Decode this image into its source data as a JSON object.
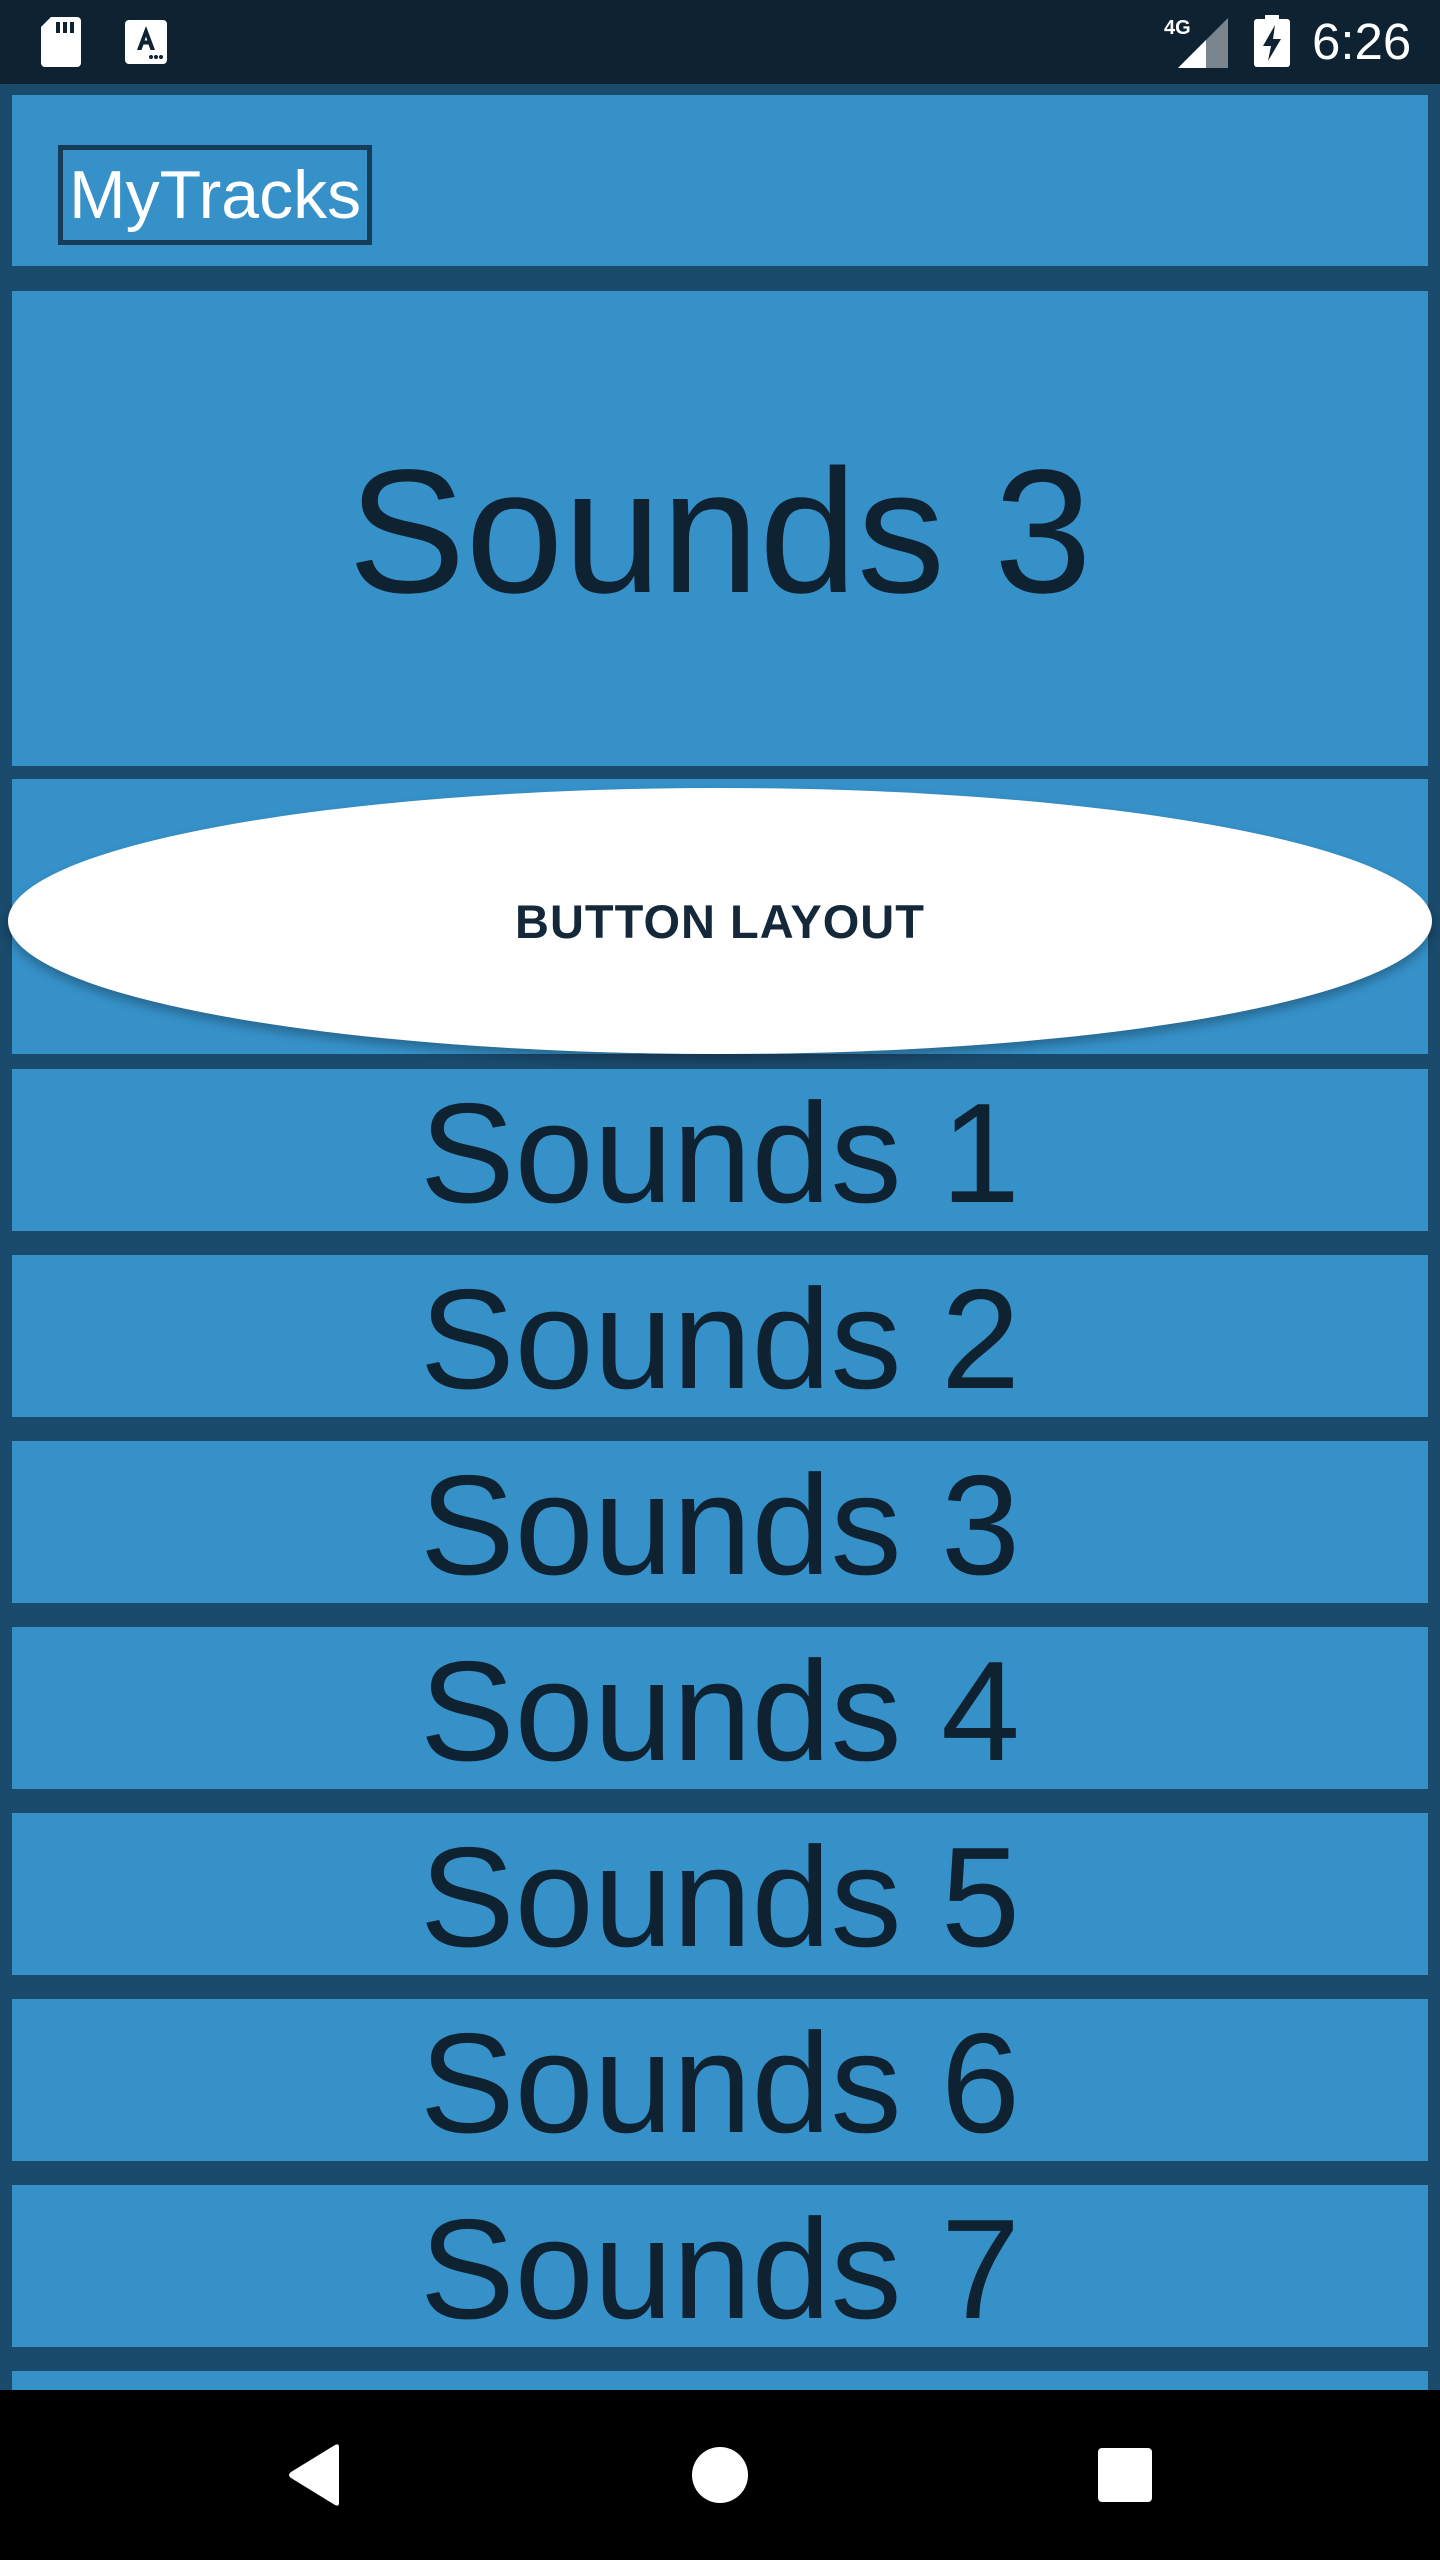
{
  "status_bar": {
    "time": "6:26",
    "network_type": "4G",
    "icons": [
      "sd-card-icon",
      "font-download-icon",
      "signal-4g-icon",
      "battery-charging-icon"
    ]
  },
  "app_bar": {
    "title": "MyTracks"
  },
  "hero": {
    "label": "Sounds 3"
  },
  "layout_button": {
    "label": "BUTTON LAYOUT"
  },
  "tracks": [
    {
      "label": "Sounds 1"
    },
    {
      "label": "Sounds 2"
    },
    {
      "label": "Sounds 3"
    },
    {
      "label": "Sounds 4"
    },
    {
      "label": "Sounds 5"
    },
    {
      "label": "Sounds 6"
    },
    {
      "label": "Sounds 7"
    }
  ],
  "nav_bar": {
    "icons": [
      "back-icon",
      "home-icon",
      "recents-icon"
    ]
  },
  "colors": {
    "status_bar_bg": "#0e2231",
    "app_bg": "#1a4a6c",
    "tile_bg": "#3691c9",
    "tile_text": "#0e2231",
    "button_bg": "#ffffff"
  }
}
